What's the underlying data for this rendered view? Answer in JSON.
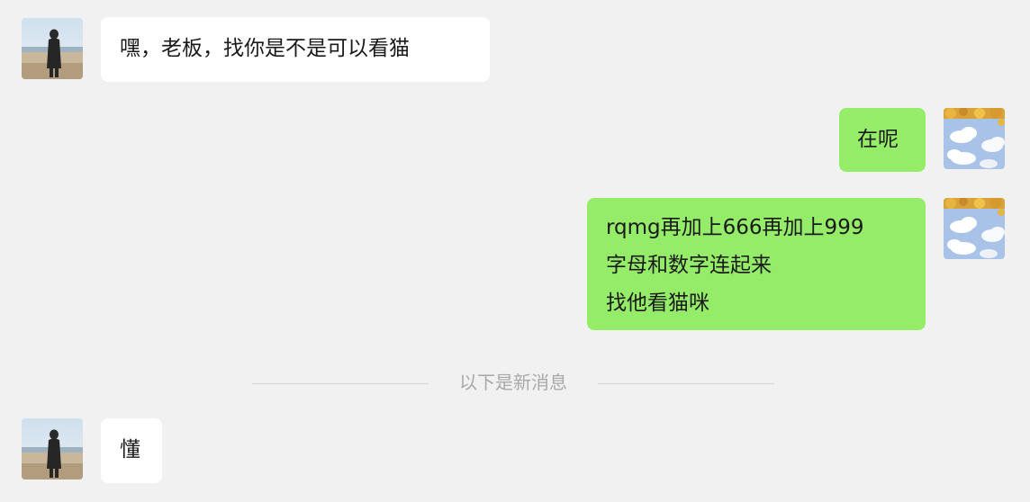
{
  "messages": [
    {
      "sender": "other",
      "avatar": "beach-person-avatar",
      "lines": [
        "嘿，老板，找你是不是可以看猫"
      ]
    },
    {
      "sender": "self",
      "avatar": "sky-flowers-avatar",
      "lines": [
        "在呢"
      ]
    },
    {
      "sender": "self",
      "avatar": "sky-flowers-avatar",
      "lines": [
        "rqmg再加上666再加上999",
        "字母和数字连起来",
        "找他看猫咪"
      ]
    },
    {
      "sender": "other",
      "avatar": "beach-person-avatar",
      "lines": [
        "懂"
      ]
    }
  ],
  "divider": {
    "label": "以下是新消息"
  },
  "colors": {
    "background": "#f1f1f1",
    "incoming_bubble": "#ffffff",
    "outgoing_bubble": "#95ec69",
    "divider_text": "#a8a8a8",
    "divider_line": "#d4d4d4"
  }
}
